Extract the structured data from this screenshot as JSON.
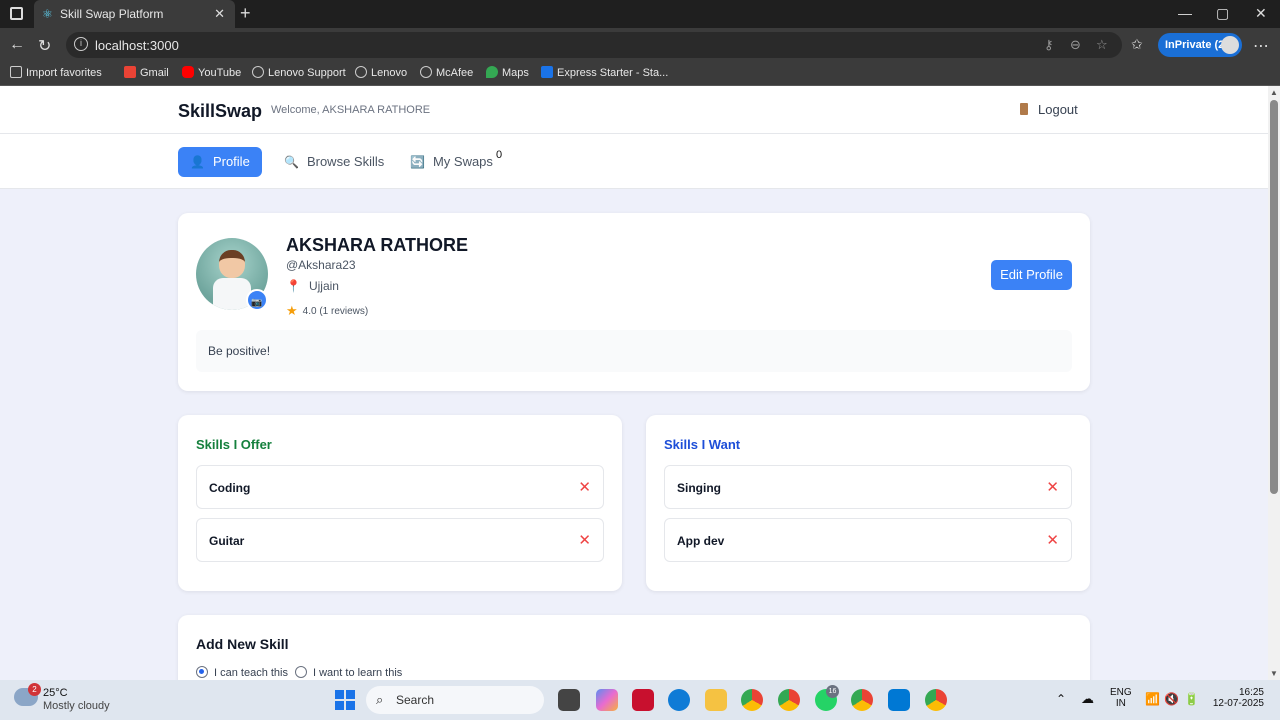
{
  "browser": {
    "tab_title": "Skill Swap Platform",
    "url": "localhost:3000",
    "inprivate_label": "InPrivate (2)",
    "bookmarks": [
      "Import favorites",
      "Gmail",
      "YouTube",
      "Lenovo Support",
      "Lenovo",
      "McAfee",
      "Maps",
      "Express Starter - Sta..."
    ]
  },
  "header": {
    "brand": "SkillSwap",
    "welcome": "Welcome, AKSHARA RATHORE",
    "logout_label": "Logout"
  },
  "nav": {
    "tabs": [
      "Profile",
      "Browse Skills",
      "My Swaps"
    ],
    "swaps_count": "0"
  },
  "profile": {
    "name": "AKSHARA RATHORE",
    "handle": "@Akshara23",
    "location": "Ujjain",
    "rating": "4.0 (1 reviews)",
    "edit_label": "Edit Profile",
    "bio": "Be positive!"
  },
  "skills_offer": {
    "title": "Skills I Offer",
    "color": "#15803d",
    "items": [
      "Coding",
      "Guitar"
    ]
  },
  "skills_want": {
    "title": "Skills I Want",
    "color": "#1d4ed8",
    "items": [
      "Singing",
      "App dev"
    ]
  },
  "add_skill": {
    "title": "Add New Skill",
    "option_teach": "I can teach this",
    "option_learn": "I want to learn this"
  },
  "taskbar": {
    "temp": "25°C",
    "weather": "Mostly cloudy",
    "weather_badge": "2",
    "search_placeholder": "Search",
    "badge_16": "16",
    "lang1": "ENG",
    "lang2": "IN",
    "time": "16:25",
    "date": "12-07-2025"
  }
}
